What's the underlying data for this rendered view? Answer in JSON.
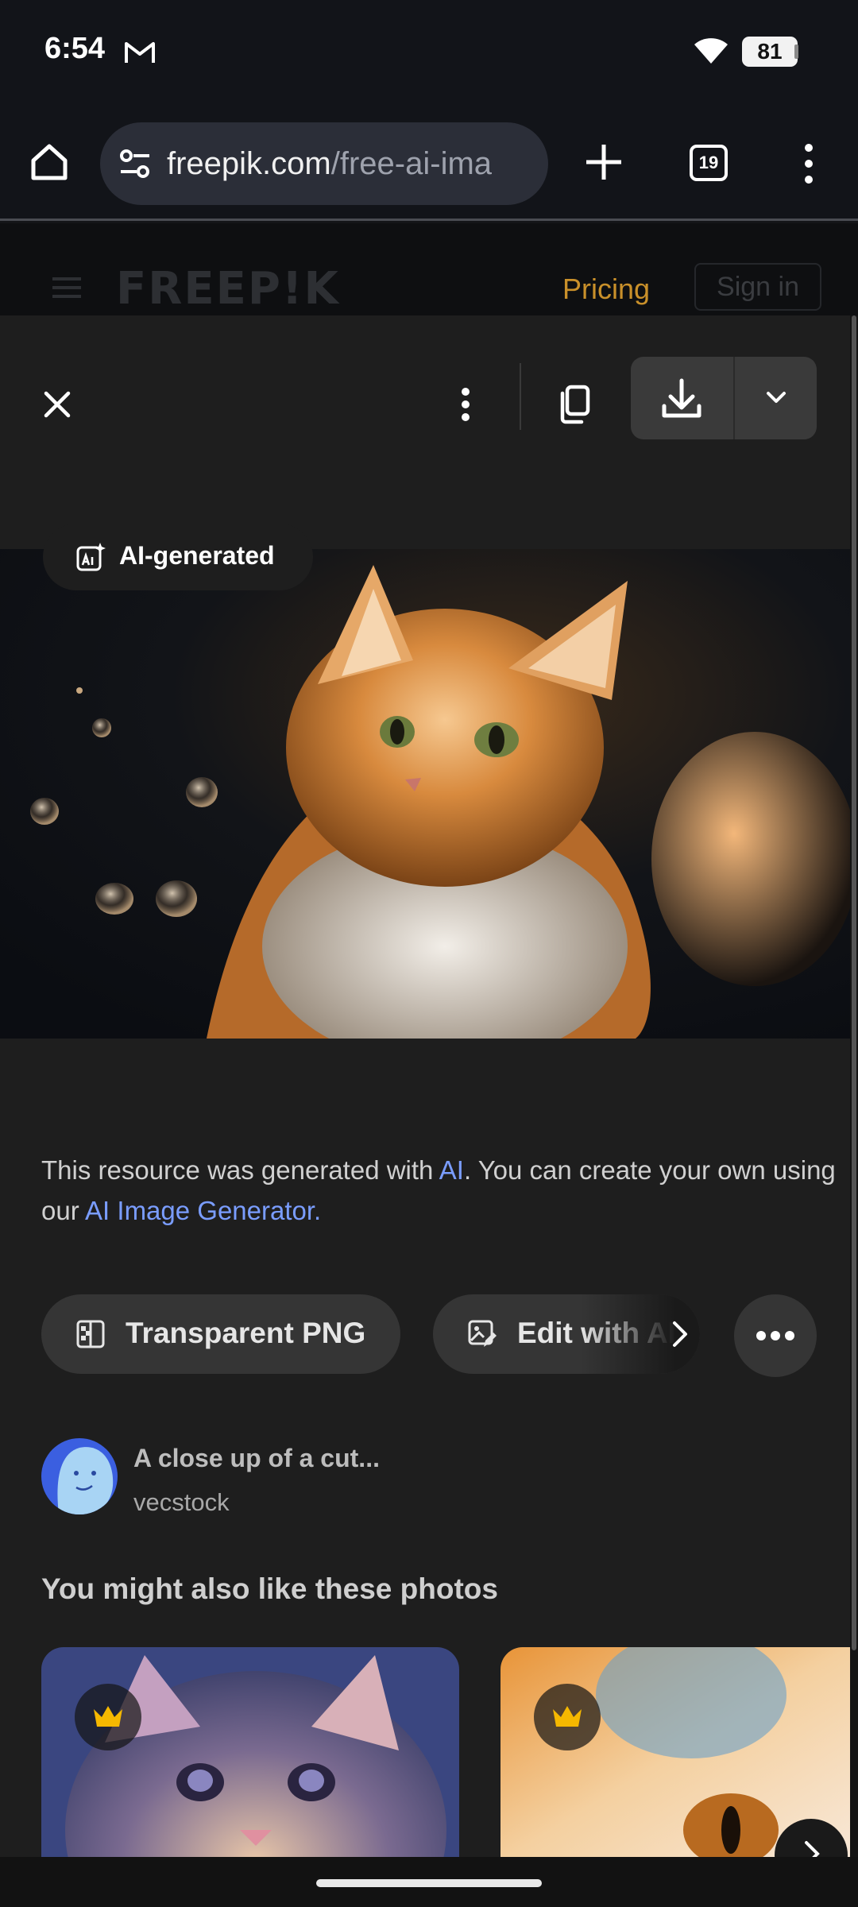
{
  "status_bar": {
    "time": "6:54",
    "battery": "81"
  },
  "browser": {
    "url_domain": "freepik.com",
    "url_path": "/free-ai-ima",
    "tab_count": "19"
  },
  "page_header": {
    "logo": "FREEP!K",
    "pricing": "Pricing",
    "signin": "Sign in"
  },
  "modal": {
    "badge": "AI-generated",
    "description_pre": "This resource was generated with ",
    "description_ai_link": "AI",
    "description_mid": ". You can create your own using our ",
    "description_gen_link": "AI Image Generator.",
    "chip_png": "Transparent PNG",
    "chip_edit": "Edit with AI",
    "author_title": "A close up of a cut...",
    "author_name": "vecstock",
    "section_title": "You might also like these photos"
  },
  "colors": {
    "accent_link": "#7a9dff",
    "crown": "#f5b800",
    "pricing": "#c9902a"
  }
}
